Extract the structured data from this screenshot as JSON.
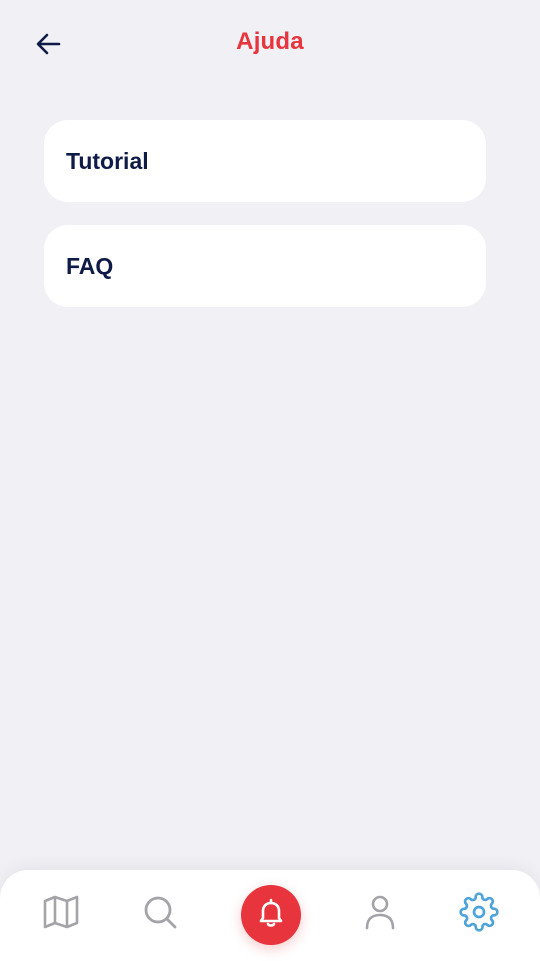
{
  "header": {
    "title": "Ajuda",
    "back_icon": "arrow-left-icon"
  },
  "menu": {
    "items": [
      {
        "label": "Tutorial"
      },
      {
        "label": "FAQ"
      }
    ]
  },
  "bottom_nav": {
    "items": [
      {
        "icon": "map-icon",
        "active": false
      },
      {
        "icon": "search-icon",
        "active": false
      },
      {
        "icon": "bell-icon",
        "active": false,
        "emphasized": true
      },
      {
        "icon": "user-icon",
        "active": false
      },
      {
        "icon": "gear-icon",
        "active": true
      }
    ]
  },
  "colors": {
    "accent": "#e8343c",
    "text_dark": "#0e1b47",
    "background": "#f0f0f5",
    "card": "#ffffff",
    "nav_inactive": "#a3a3a8",
    "nav_active": "#4ea3d9"
  }
}
